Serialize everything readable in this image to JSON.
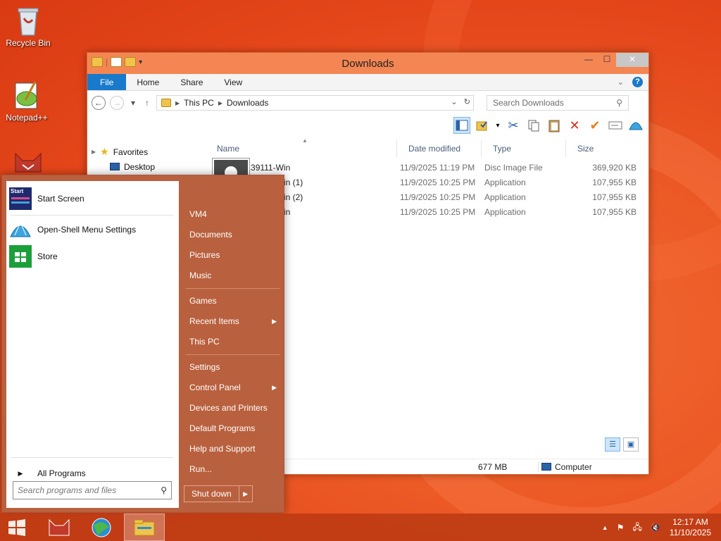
{
  "desktop": {
    "icons": [
      {
        "label": "Recycle Bin"
      },
      {
        "label": "Notepad++"
      },
      {
        "label": ""
      }
    ]
  },
  "explorer": {
    "title": "Downloads",
    "ribbon_tabs": [
      "File",
      "Home",
      "Share",
      "View"
    ],
    "breadcrumb": [
      "This PC",
      "Downloads"
    ],
    "search_placeholder": "Search Downloads",
    "nav": {
      "favorites": "Favorites",
      "desktop": "Desktop"
    },
    "columns": [
      "Name",
      "Date modified",
      "Type",
      "Size"
    ],
    "files": [
      {
        "name": "44-139111-Win",
        "date": "11/9/2025 11:19 PM",
        "type": "Disc Image File",
        "size": "369,920 KB"
      },
      {
        "name": "44-139111-Win (1)",
        "date": "11/9/2025 10:25 PM",
        "type": "Application",
        "size": "107,955 KB"
      },
      {
        "name": "44-139111-Win (2)",
        "date": "11/9/2025 10:25 PM",
        "type": "Application",
        "size": "107,955 KB"
      },
      {
        "name": "44-139111-Win",
        "date": "11/9/2025 10:25 PM",
        "type": "Application",
        "size": "107,955 KB"
      }
    ],
    "status": {
      "size": "677 MB",
      "location": "Computer"
    }
  },
  "start_menu": {
    "left_items": [
      {
        "label": "Start Screen",
        "badge": "Start"
      },
      {
        "label": "Open-Shell Menu Settings"
      },
      {
        "label": "Store"
      }
    ],
    "all_programs": "All Programs",
    "search_placeholder": "Search programs and files",
    "right_items": [
      {
        "label": "VM4"
      },
      {
        "label": "Documents"
      },
      {
        "label": "Pictures"
      },
      {
        "label": "Music"
      },
      {
        "label": "Games"
      },
      {
        "label": "Recent Items"
      },
      {
        "label": "This PC"
      },
      {
        "label": "Settings"
      },
      {
        "label": "Control Panel"
      },
      {
        "label": "Devices and Printers"
      },
      {
        "label": "Default Programs"
      },
      {
        "label": "Help and Support"
      },
      {
        "label": "Run..."
      }
    ],
    "shutdown": "Shut down"
  },
  "taskbar": {
    "time": "12:17 AM",
    "date": "11/10/2025"
  },
  "colors": {
    "accent": "#1979ca",
    "title_bar": "#f38652",
    "start_menu": "#b9613f",
    "taskbar": "#be3c14"
  }
}
